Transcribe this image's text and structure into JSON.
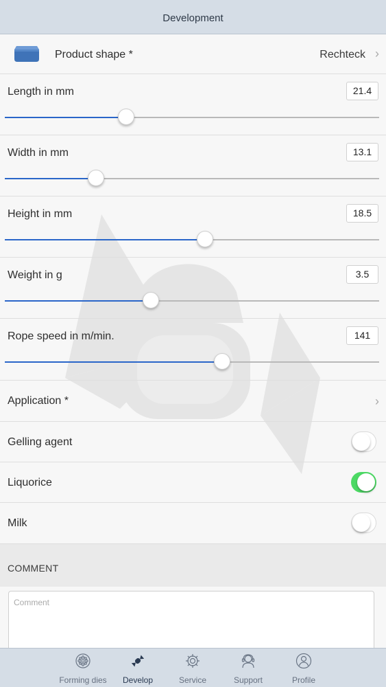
{
  "header": {
    "title": "Development"
  },
  "product_shape": {
    "label": "Product shape *",
    "value": "Rechteck"
  },
  "sliders": [
    {
      "label": "Length in mm",
      "value": "21.4",
      "fraction": 0.325
    },
    {
      "label": "Width in mm",
      "value": "13.1",
      "fraction": 0.243
    },
    {
      "label": "Height in mm",
      "value": "18.5",
      "fraction": 0.534
    },
    {
      "label": "Weight in g",
      "value": "3.5",
      "fraction": 0.39
    },
    {
      "label": "Rope speed in m/min.",
      "value": "141",
      "fraction": 0.58
    }
  ],
  "application": {
    "label": "Application *"
  },
  "toggles": [
    {
      "label": "Gelling agent",
      "on": false
    },
    {
      "label": "Liquorice",
      "on": true
    },
    {
      "label": "Milk",
      "on": false
    }
  ],
  "comment": {
    "header": "COMMENT",
    "placeholder": "Comment"
  },
  "tabs": [
    {
      "label": "Forming dies",
      "icon": "forming-dies-icon",
      "active": false
    },
    {
      "label": "Develop",
      "icon": "develop-icon",
      "active": true
    },
    {
      "label": "Service",
      "icon": "service-icon",
      "active": false
    },
    {
      "label": "Support",
      "icon": "support-icon",
      "active": false
    },
    {
      "label": "Profile",
      "icon": "profile-icon",
      "active": false
    }
  ],
  "colors": {
    "accent": "#2a66c9",
    "switch_on": "#4cd964",
    "bar": "#d5dde6"
  }
}
